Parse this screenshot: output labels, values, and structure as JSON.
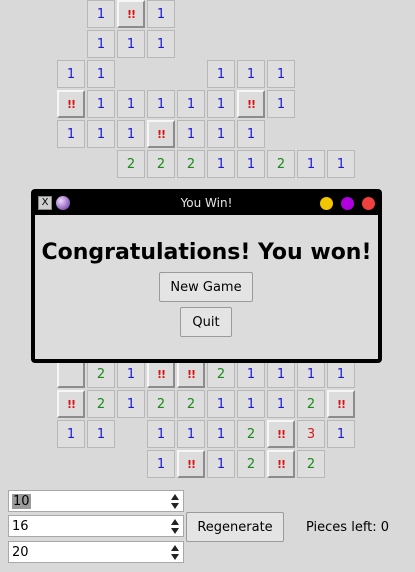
{
  "board": {
    "rows": [
      {
        "r": 0,
        "cells": [
          {
            "c": 3,
            "v": "1"
          },
          {
            "c": 4,
            "v": "!!"
          },
          {
            "c": 5,
            "v": "1"
          }
        ]
      },
      {
        "r": 1,
        "cells": [
          {
            "c": 3,
            "v": "1"
          },
          {
            "c": 4,
            "v": "1"
          },
          {
            "c": 5,
            "v": "1"
          }
        ]
      },
      {
        "r": 2,
        "cells": [
          {
            "c": 2,
            "v": "1"
          },
          {
            "c": 3,
            "v": "1"
          },
          {
            "c": 7,
            "v": "1"
          },
          {
            "c": 8,
            "v": "1"
          },
          {
            "c": 9,
            "v": "1"
          }
        ]
      },
      {
        "r": 3,
        "cells": [
          {
            "c": 2,
            "v": "!!"
          },
          {
            "c": 3,
            "v": "1"
          },
          {
            "c": 4,
            "v": "1"
          },
          {
            "c": 5,
            "v": "1"
          },
          {
            "c": 6,
            "v": "1"
          },
          {
            "c": 7,
            "v": "1"
          },
          {
            "c": 8,
            "v": "!!"
          },
          {
            "c": 9,
            "v": "1"
          }
        ]
      },
      {
        "r": 4,
        "cells": [
          {
            "c": 2,
            "v": "1"
          },
          {
            "c": 3,
            "v": "1"
          },
          {
            "c": 4,
            "v": "1"
          },
          {
            "c": 5,
            "v": "!!"
          },
          {
            "c": 6,
            "v": "1"
          },
          {
            "c": 7,
            "v": "1"
          },
          {
            "c": 8,
            "v": "1"
          }
        ]
      },
      {
        "r": 5,
        "cells": [
          {
            "c": 4,
            "v": "2"
          },
          {
            "c": 5,
            "v": "2"
          },
          {
            "c": 6,
            "v": "2"
          },
          {
            "c": 7,
            "v": "1"
          },
          {
            "c": 8,
            "v": "1"
          },
          {
            "c": 9,
            "v": "2"
          },
          {
            "c": 10,
            "v": "1"
          },
          {
            "c": 11,
            "v": "1"
          }
        ]
      },
      {
        "r": 12,
        "cells": [
          {
            "c": 2,
            "v": ""
          },
          {
            "c": 3,
            "v": "2"
          },
          {
            "c": 4,
            "v": "1"
          },
          {
            "c": 5,
            "v": "!!"
          },
          {
            "c": 6,
            "v": "!!"
          },
          {
            "c": 7,
            "v": "2"
          },
          {
            "c": 8,
            "v": "1"
          },
          {
            "c": 9,
            "v": "1"
          },
          {
            "c": 10,
            "v": "1"
          },
          {
            "c": 11,
            "v": "1"
          }
        ]
      },
      {
        "r": 13,
        "cells": [
          {
            "c": 2,
            "v": "!!"
          },
          {
            "c": 3,
            "v": "2"
          },
          {
            "c": 4,
            "v": "1"
          },
          {
            "c": 5,
            "v": "2"
          },
          {
            "c": 6,
            "v": "2"
          },
          {
            "c": 7,
            "v": "1"
          },
          {
            "c": 8,
            "v": "1"
          },
          {
            "c": 9,
            "v": "1"
          },
          {
            "c": 10,
            "v": "2"
          },
          {
            "c": 11,
            "v": "!!"
          }
        ]
      },
      {
        "r": 14,
        "cells": [
          {
            "c": 2,
            "v": "1"
          },
          {
            "c": 3,
            "v": "1"
          },
          {
            "c": 5,
            "v": "1"
          },
          {
            "c": 6,
            "v": "1"
          },
          {
            "c": 7,
            "v": "1"
          },
          {
            "c": 8,
            "v": "2"
          },
          {
            "c": 9,
            "v": "!!"
          },
          {
            "c": 10,
            "v": "3"
          },
          {
            "c": 11,
            "v": "1"
          }
        ]
      },
      {
        "r": 15,
        "cells": [
          {
            "c": 5,
            "v": "1"
          },
          {
            "c": 6,
            "v": "!!"
          },
          {
            "c": 7,
            "v": "1"
          },
          {
            "c": 8,
            "v": "2"
          },
          {
            "c": 9,
            "v": "!!"
          },
          {
            "c": 10,
            "v": "2"
          }
        ]
      }
    ]
  },
  "dialog": {
    "title": "You Win!",
    "message": "Congratulations! You won!",
    "new_game_label": "New Game",
    "quit_label": "Quit"
  },
  "controls": {
    "field1": "10",
    "field2": "16",
    "field3": "20",
    "regenerate_label": "Regenerate",
    "pieces_left": "Pieces left: 0"
  },
  "colors": {
    "one": "#1a1ad8",
    "two": "#1a8a1a",
    "three": "#d81a1a",
    "flag": "#e01010"
  }
}
